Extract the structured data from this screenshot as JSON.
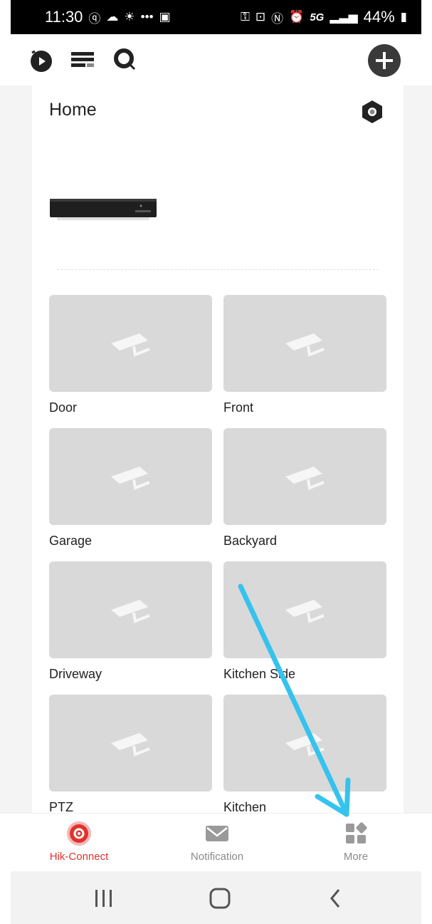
{
  "status_bar": {
    "time": "11:30",
    "left_icons": [
      "qb-icon",
      "cloud-icon",
      "brightness-icon",
      "dots-icon",
      "image-icon"
    ],
    "right_icons": [
      "key-icon",
      "lock-icon",
      "nfc-icon",
      "alarm-icon"
    ],
    "network": "5G",
    "battery": "44%"
  },
  "toolbar": {
    "left_buttons": [
      "play-history-icon",
      "list-view-icon",
      "search-icon"
    ],
    "right_button": "add-icon"
  },
  "site": {
    "title": "Home",
    "settings_icon": "hex-settings-icon",
    "device_icon": "nvr-device-icon"
  },
  "cameras": [
    {
      "name": "Door"
    },
    {
      "name": "Front"
    },
    {
      "name": "Garage"
    },
    {
      "name": "Backyard"
    },
    {
      "name": "Driveway"
    },
    {
      "name": "Kitchen Side"
    },
    {
      "name": "PTZ"
    },
    {
      "name": "Kitchen"
    }
  ],
  "bottom_nav": [
    {
      "label": "Hik-Connect",
      "icon": "hik-connect-icon",
      "active": true
    },
    {
      "label": "Notification",
      "icon": "envelope-icon",
      "active": false
    },
    {
      "label": "More",
      "icon": "grid-more-icon",
      "active": false
    }
  ],
  "system_nav": [
    "recents-icon",
    "home-icon",
    "back-icon"
  ],
  "colors": {
    "accent": "#e0322c",
    "card_bg": "#ffffff",
    "page_bg": "#f4f4f4",
    "thumbnail_bg": "#d9d9d9",
    "annotation_arrow": "#35c3ee"
  }
}
